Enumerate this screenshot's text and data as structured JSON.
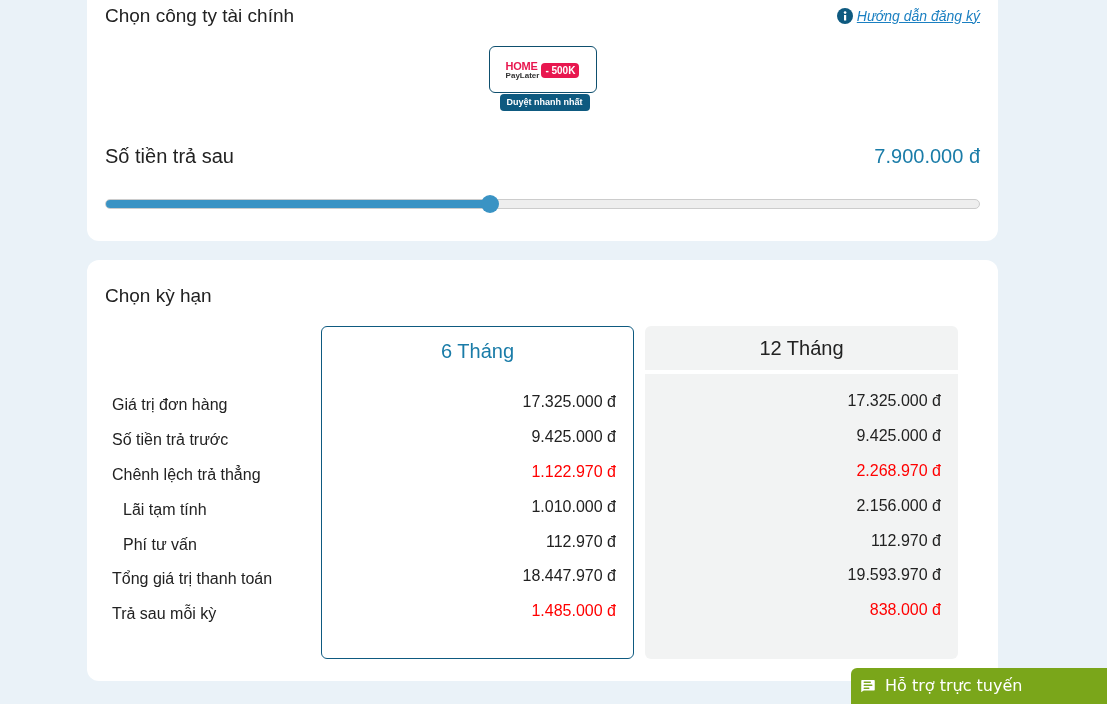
{
  "lender_section": {
    "title": "Chọn công ty tài chính",
    "help_link": "Hướng dẫn đăng ký",
    "lenders": [
      {
        "brand_top": "HOME",
        "brand_bottom": "PayLater",
        "promo": "- 500K",
        "badge": "Duyệt nhanh nhất",
        "selected": false
      }
    ]
  },
  "amount": {
    "label": "Số tiền trả sau",
    "value": "7.900.000 đ",
    "level": 0.44
  },
  "term_section": {
    "title": "Chọn kỳ hạn",
    "row_labels": [
      {
        "text": "Giá trị đơn hàng",
        "kind": "main",
        "highlight": false
      },
      {
        "text": "Số tiền trả trước",
        "kind": "main",
        "highlight": false
      },
      {
        "text": "Chênh lệch trả thẳng",
        "kind": "main",
        "highlight": true
      },
      {
        "text": "Lãi tạm tính",
        "kind": "sub",
        "highlight": false
      },
      {
        "text": "Phí tư vấn",
        "kind": "sub",
        "highlight": false
      },
      {
        "text": "Tổng giá trị thanh toán",
        "kind": "main",
        "highlight": false
      },
      {
        "text": "Trả sau mỗi kỳ",
        "kind": "main",
        "highlight": true
      }
    ],
    "plans": [
      {
        "title": "6 Tháng",
        "selected": true,
        "values": [
          "17.325.000 đ",
          "9.425.000 đ",
          "1.122.970 đ",
          "1.010.000 đ",
          "112.970 đ",
          "18.447.970 đ",
          "1.485.000 đ"
        ]
      },
      {
        "title": "12 Tháng",
        "selected": false,
        "values": [
          "17.325.000 đ",
          "9.425.000 đ",
          "2.268.970 đ",
          "2.156.000 đ",
          "112.970 đ",
          "19.593.970 đ",
          "838.000 đ"
        ]
      }
    ]
  },
  "chat_button": "Hỗ trợ trực tuyến"
}
